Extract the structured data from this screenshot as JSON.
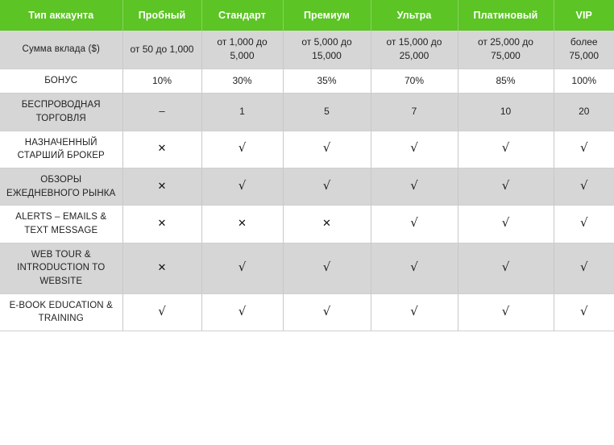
{
  "table": {
    "columns": [
      {
        "label": "Тип аккаунта",
        "key": "label"
      },
      {
        "label": "Пробный",
        "key": "trial"
      },
      {
        "label": "Стандарт",
        "key": "standard"
      },
      {
        "label": "Премиум",
        "key": "premium"
      },
      {
        "label": "Ультра",
        "key": "ultra"
      },
      {
        "label": "Платиновый",
        "key": "platinum"
      },
      {
        "label": "VIP",
        "key": "vip"
      }
    ],
    "rows": [
      {
        "label": "Сумма вклада ($)",
        "shaded": true,
        "cells": [
          {
            "type": "text",
            "value": "от 50 до 1,000"
          },
          {
            "type": "text",
            "value": "от 1,000 до 5,000"
          },
          {
            "type": "text",
            "value": "от 5,000 до 15,000"
          },
          {
            "type": "text",
            "value": "от 15,000 до 25,000"
          },
          {
            "type": "text",
            "value": "от 25,000 до 75,000"
          },
          {
            "type": "text",
            "value": "более 75,000"
          }
        ]
      },
      {
        "label": "БОНУС",
        "shaded": false,
        "cells": [
          {
            "type": "text",
            "value": "10%"
          },
          {
            "type": "text",
            "value": "30%"
          },
          {
            "type": "text",
            "value": "35%"
          },
          {
            "type": "text",
            "value": "70%"
          },
          {
            "type": "text",
            "value": "85%"
          },
          {
            "type": "text",
            "value": "100%"
          }
        ]
      },
      {
        "label": "БЕСПРОВОДНАЯ ТОРГОВЛЯ",
        "shaded": true,
        "cells": [
          {
            "type": "dash",
            "value": "–"
          },
          {
            "type": "text",
            "value": "1"
          },
          {
            "type": "text",
            "value": "5"
          },
          {
            "type": "text",
            "value": "7"
          },
          {
            "type": "text",
            "value": "10"
          },
          {
            "type": "text",
            "value": "20"
          }
        ]
      },
      {
        "label": "НАЗНАЧЕННЫЙ СТАРШИЙ БРОКЕР",
        "shaded": false,
        "cells": [
          {
            "type": "cross",
            "value": "✕"
          },
          {
            "type": "check",
            "value": "√"
          },
          {
            "type": "check",
            "value": "√"
          },
          {
            "type": "check",
            "value": "√"
          },
          {
            "type": "check",
            "value": "√"
          },
          {
            "type": "check",
            "value": "√"
          }
        ]
      },
      {
        "label": "ОБЗОРЫ ЕЖЕДНЕВНОГО РЫНКА",
        "shaded": true,
        "cells": [
          {
            "type": "cross",
            "value": "✕"
          },
          {
            "type": "check",
            "value": "√"
          },
          {
            "type": "check",
            "value": "√"
          },
          {
            "type": "check",
            "value": "√"
          },
          {
            "type": "check",
            "value": "√"
          },
          {
            "type": "check",
            "value": "√"
          }
        ]
      },
      {
        "label": "ALERTS – EMAILS & TEXT MESSAGE",
        "shaded": false,
        "cells": [
          {
            "type": "cross",
            "value": "✕"
          },
          {
            "type": "cross",
            "value": "✕"
          },
          {
            "type": "cross",
            "value": "✕"
          },
          {
            "type": "check",
            "value": "√"
          },
          {
            "type": "check",
            "value": "√"
          },
          {
            "type": "check",
            "value": "√"
          }
        ]
      },
      {
        "label": "WEB TOUR & INTRODUCTION TO WEBSITE",
        "shaded": true,
        "cells": [
          {
            "type": "cross",
            "value": "✕"
          },
          {
            "type": "check",
            "value": "√"
          },
          {
            "type": "check",
            "value": "√"
          },
          {
            "type": "check",
            "value": "√"
          },
          {
            "type": "check",
            "value": "√"
          },
          {
            "type": "check",
            "value": "√"
          }
        ]
      },
      {
        "label": "E-BOOK EDUCATION & TRAINING",
        "shaded": false,
        "cells": [
          {
            "type": "check",
            "value": "√"
          },
          {
            "type": "check",
            "value": "√"
          },
          {
            "type": "check",
            "value": "√"
          },
          {
            "type": "check",
            "value": "√"
          },
          {
            "type": "check",
            "value": "√"
          },
          {
            "type": "check",
            "value": "√"
          }
        ]
      }
    ]
  },
  "colors": {
    "header_green": "#5cc425",
    "header_divider": "#86d45e",
    "row_shade": "#d6d6d6",
    "row_plain": "#ffffff",
    "cell_divider": "#c8c8c8",
    "text": "#222222",
    "header_text": "#ffffff"
  }
}
